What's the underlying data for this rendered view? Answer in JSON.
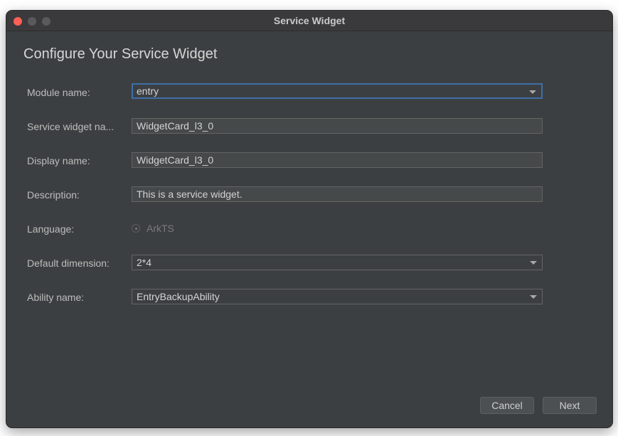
{
  "window": {
    "title": "Service Widget",
    "heading": "Configure Your Service Widget"
  },
  "form": {
    "module_name": {
      "label": "Module name:",
      "value": "entry"
    },
    "service_widget_name": {
      "label": "Service widget na...",
      "value": "WidgetCard_l3_0"
    },
    "display_name": {
      "label": "Display name:",
      "value": "WidgetCard_l3_0"
    },
    "description": {
      "label": "Description:",
      "value": "This is a service widget."
    },
    "language": {
      "label": "Language:",
      "option": "ArkTS"
    },
    "default_dimension": {
      "label": "Default dimension:",
      "value": "2*4"
    },
    "ability_name": {
      "label": "Ability name:",
      "value": "EntryBackupAbility"
    }
  },
  "buttons": {
    "cancel": "Cancel",
    "next": "Next"
  },
  "colors": {
    "window_bg": "#3c3f41",
    "close_button": "#fe5f57",
    "focus_border": "#3d6fa8"
  },
  "icons": {
    "dropdown": "chevron-down-icon",
    "radio": "radio-icon"
  }
}
